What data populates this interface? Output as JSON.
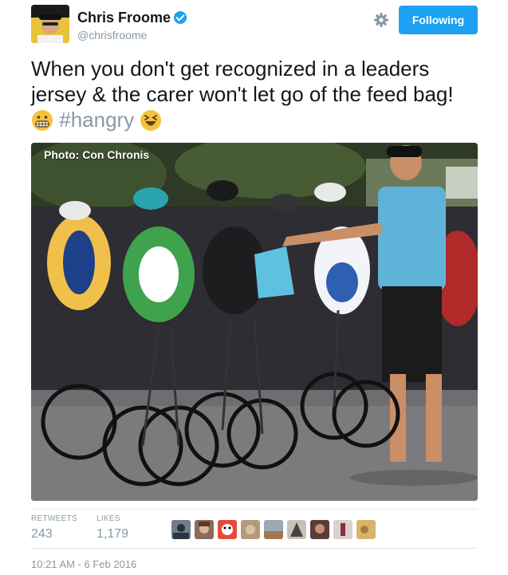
{
  "user": {
    "name": "Chris Froome",
    "handle": "@chrisfroome",
    "verified": true
  },
  "follow_button": {
    "label": "Following"
  },
  "tweet": {
    "text": "When you don't get recognized in a leaders jersey & the carer won't let go of the feed bag!",
    "hashtag": "#hangry",
    "emoji_before": "grimacing-face",
    "emoji_after": "laughing-face"
  },
  "photo": {
    "caption": "Photo:  Con Chronis"
  },
  "stats": {
    "retweets_label": "RETWEETS",
    "retweets_value": "243",
    "likes_label": "LIKES",
    "likes_value": "1,179"
  },
  "timestamp": "10:21 AM - 6 Feb 2016",
  "colors": {
    "accent": "#1da1f2",
    "muted": "#8899a6",
    "text": "#14171a"
  }
}
